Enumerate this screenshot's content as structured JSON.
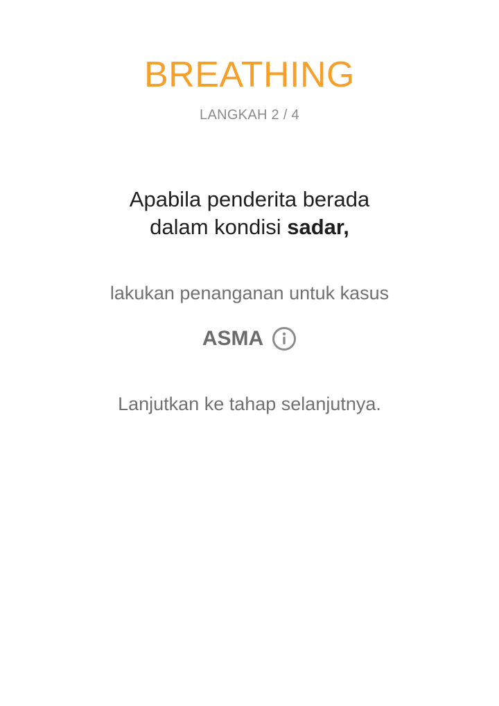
{
  "header": {
    "title": "BREATHING",
    "step": "LANGKAH 2 / 4"
  },
  "content": {
    "condition_prefix": "Apabila penderita berada",
    "condition_line2_prefix": "dalam kondisi ",
    "condition_bold": "sadar",
    "condition_suffix": ",",
    "instruction": "lakukan penanganan untuk kasus",
    "case_label": "ASMA",
    "case_icon": "info-icon",
    "next_text": "Lanjutkan ke tahap selanjutnya."
  },
  "colors": {
    "accent": "#f5a02a",
    "secondary_text": "#707070",
    "primary_text": "#1e1e1e"
  }
}
